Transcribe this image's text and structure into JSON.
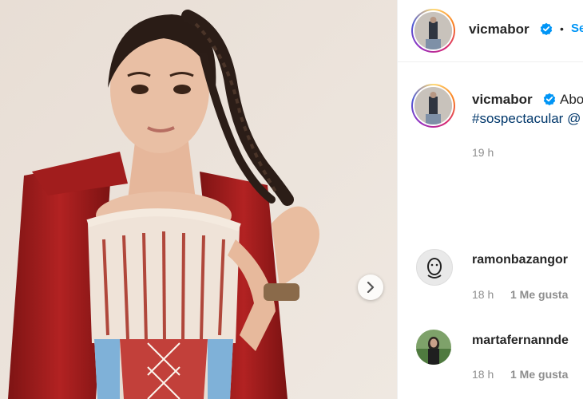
{
  "header": {
    "username": "vicmabor",
    "separator": "•",
    "follow_label": "Se"
  },
  "caption": {
    "username": "vicmabor",
    "text": "Abo",
    "hashtag": "#sospectacular @",
    "time": "19 h"
  },
  "comments": [
    {
      "username": "ramonbazangor",
      "time": "18 h",
      "likes": "1 Me gusta"
    },
    {
      "username": "martafernannde",
      "time": "18 h",
      "likes": "1 Me gusta"
    }
  ],
  "icons": {
    "verified": "verified-badge-icon",
    "next": "chevron-right-icon"
  },
  "colors": {
    "link_blue": "#0095f6",
    "hashtag": "#00376b",
    "verified": "#0095f6",
    "secondary_text": "#8e8e8e"
  }
}
